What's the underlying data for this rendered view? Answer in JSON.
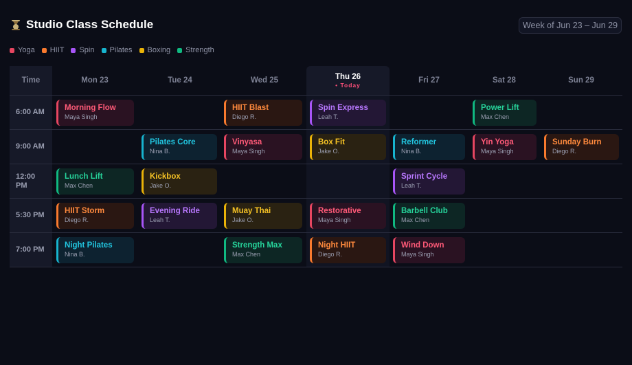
{
  "header": {
    "title": "Studio Class Schedule",
    "logo_icon": "kettlebell-icon"
  },
  "week_button": {
    "label": "Week of Jun 23 – Jun 29"
  },
  "legend": [
    {
      "label": "Yoga",
      "color": "#e74661"
    },
    {
      "label": "HIIT",
      "color": "#f97a2e"
    },
    {
      "label": "Spin",
      "color": "#a855f7"
    },
    {
      "label": "Pilates",
      "color": "#17b4cf"
    },
    {
      "label": "Boxing",
      "color": "#eab308"
    },
    {
      "label": "Strength",
      "color": "#10b981"
    }
  ],
  "grid": {
    "time_header": "Time",
    "days": [
      "Mon 23",
      "Tue 24",
      "Wed 25",
      "Thu 26",
      "Fri 27",
      "Sat 28",
      "Sun 29"
    ],
    "today_label": "• Today",
    "rows": [
      {
        "time": "6:00 AM",
        "classes": [
          {
            "name": "Morning Flow",
            "trainer": "Maya Singh"
          },
          {
            "name": "HIIT Blast",
            "trainer": "Diego R."
          },
          {
            "name": "Spin Express",
            "trainer": "Leah T."
          },
          {
            "name": "Power Lift",
            "trainer": "Max Chen"
          }
        ]
      },
      {
        "time": "9:00 AM",
        "classes": [
          {
            "name": "Pilates Core",
            "trainer": "Nina B."
          },
          {
            "name": "Vinyasa",
            "trainer": "Maya Singh"
          },
          {
            "name": "Box Fit",
            "trainer": "Jake O."
          },
          {
            "name": "Reformer",
            "trainer": "Nina B."
          },
          {
            "name": "Yin Yoga",
            "trainer": "Maya Singh"
          },
          {
            "name": "Sunday Burn",
            "trainer": "Diego R."
          }
        ]
      },
      {
        "time": "12:00 PM",
        "classes": [
          {
            "name": "Lunch Lift",
            "trainer": "Max Chen"
          },
          {
            "name": "Kickbox",
            "trainer": "Jake O."
          },
          {
            "name": "Sprint Cycle",
            "trainer": "Leah T."
          }
        ]
      },
      {
        "time": "5:30 PM",
        "classes": [
          {
            "name": "HIIT Storm",
            "trainer": "Diego R."
          },
          {
            "name": "Evening Ride",
            "trainer": "Leah T."
          },
          {
            "name": "Muay Thai",
            "trainer": "Jake O."
          },
          {
            "name": "Restorative",
            "trainer": "Maya Singh"
          },
          {
            "name": "Barbell Club",
            "trainer": "Max Chen"
          }
        ]
      },
      {
        "time": "7:00 PM",
        "classes": [
          {
            "name": "Night Pilates",
            "trainer": "Nina B."
          },
          {
            "name": "Strength Max",
            "trainer": "Max Chen"
          },
          {
            "name": "Night HIIT",
            "trainer": "Diego R."
          },
          {
            "name": "Wind Down",
            "trainer": "Maya Singh"
          }
        ]
      }
    ]
  }
}
